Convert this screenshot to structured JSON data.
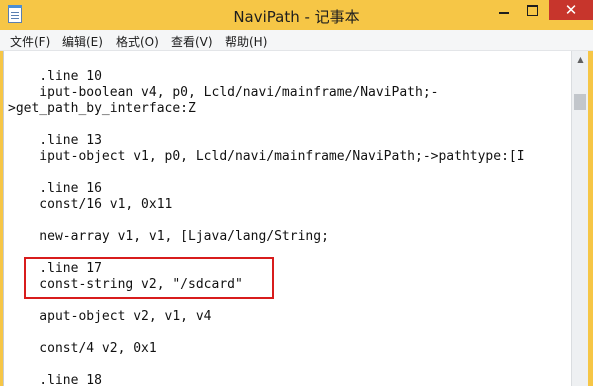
{
  "window": {
    "title": "NaviPath - 记事本",
    "close_glyph": "✕",
    "accent_color": "#f6c646",
    "close_color": "#c7352c"
  },
  "menu": {
    "items": [
      "文件(F)",
      "编辑(E)",
      "格式(O)",
      "查看(V)",
      "帮助(H)"
    ]
  },
  "editor": {
    "lines": [
      "    .line 10",
      "    iput-boolean v4, p0, Lcld/navi/mainframe/NaviPath;-",
      ">get_path_by_interface:Z",
      "",
      "    .line 13",
      "    iput-object v1, p0, Lcld/navi/mainframe/NaviPath;->pathtype:[I",
      "",
      "    .line 16",
      "    const/16 v1, 0x11",
      "",
      "    new-array v1, v1, [Ljava/lang/String;",
      "",
      "    .line 17",
      "    const-string v2, \"/sdcard\"",
      "",
      "    aput-object v2, v1, v4",
      "",
      "    const/4 v2, 0x1",
      "",
      "    .line 18"
    ],
    "highlight_color": "#d81c1c"
  },
  "scrollbar": {
    "up_glyph": "▲"
  }
}
